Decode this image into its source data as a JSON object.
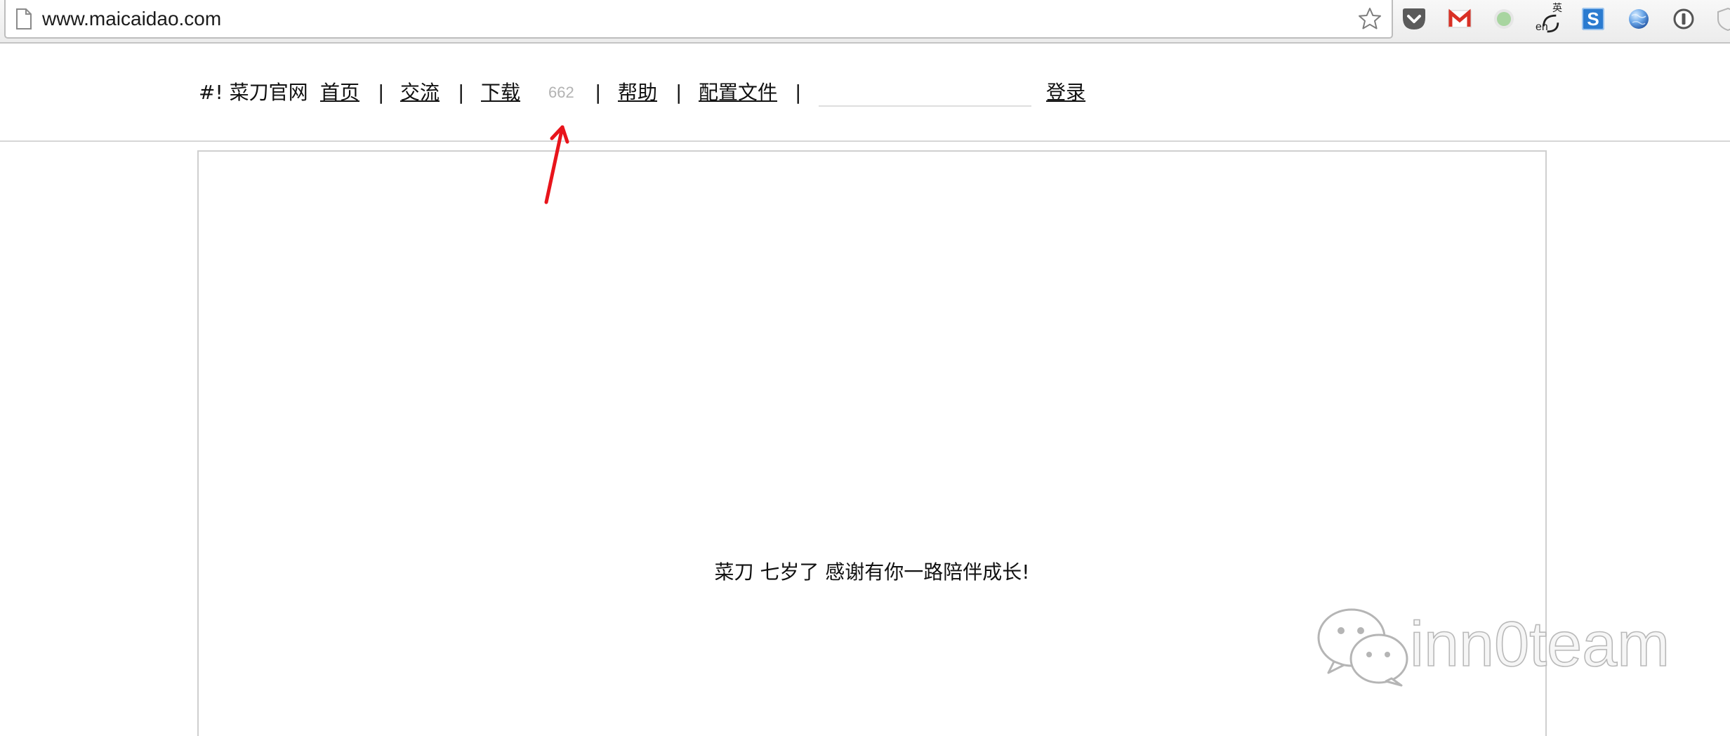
{
  "browser": {
    "url": "www.maicaidao.com",
    "page_icon": "document-icon",
    "bookmark_icon": "star-icon",
    "extensions": [
      {
        "name": "pocket-icon"
      },
      {
        "name": "gmail-icon",
        "color": "#d93025"
      },
      {
        "name": "status-circle-icon",
        "color": "#a8d5a0"
      },
      {
        "name": "translate-icon",
        "label_top": "英",
        "label_bottom": "en"
      },
      {
        "name": "s-extension-icon",
        "label": "S",
        "color": "#2b7bd0"
      },
      {
        "name": "globe-icon"
      },
      {
        "name": "1password-icon"
      },
      {
        "name": "shield-icon"
      }
    ]
  },
  "nav": {
    "brand": "#! 菜刀官网",
    "separator": "|",
    "links": {
      "home": "首页",
      "community": "交流",
      "download": "下载",
      "download_count": "662",
      "help": "帮助",
      "config": "配置文件",
      "login": "登录"
    },
    "search_value": ""
  },
  "main": {
    "message": "菜刀 七岁了 感谢有你一路陪伴成长!"
  },
  "watermark": {
    "logo_icon": "wechat-icon",
    "text": "inn0team"
  },
  "colors": {
    "link": "#0000ee",
    "link_visited": "#551a8b",
    "count_gray": "#b3b3b3",
    "annotation_red": "#e8141b"
  }
}
